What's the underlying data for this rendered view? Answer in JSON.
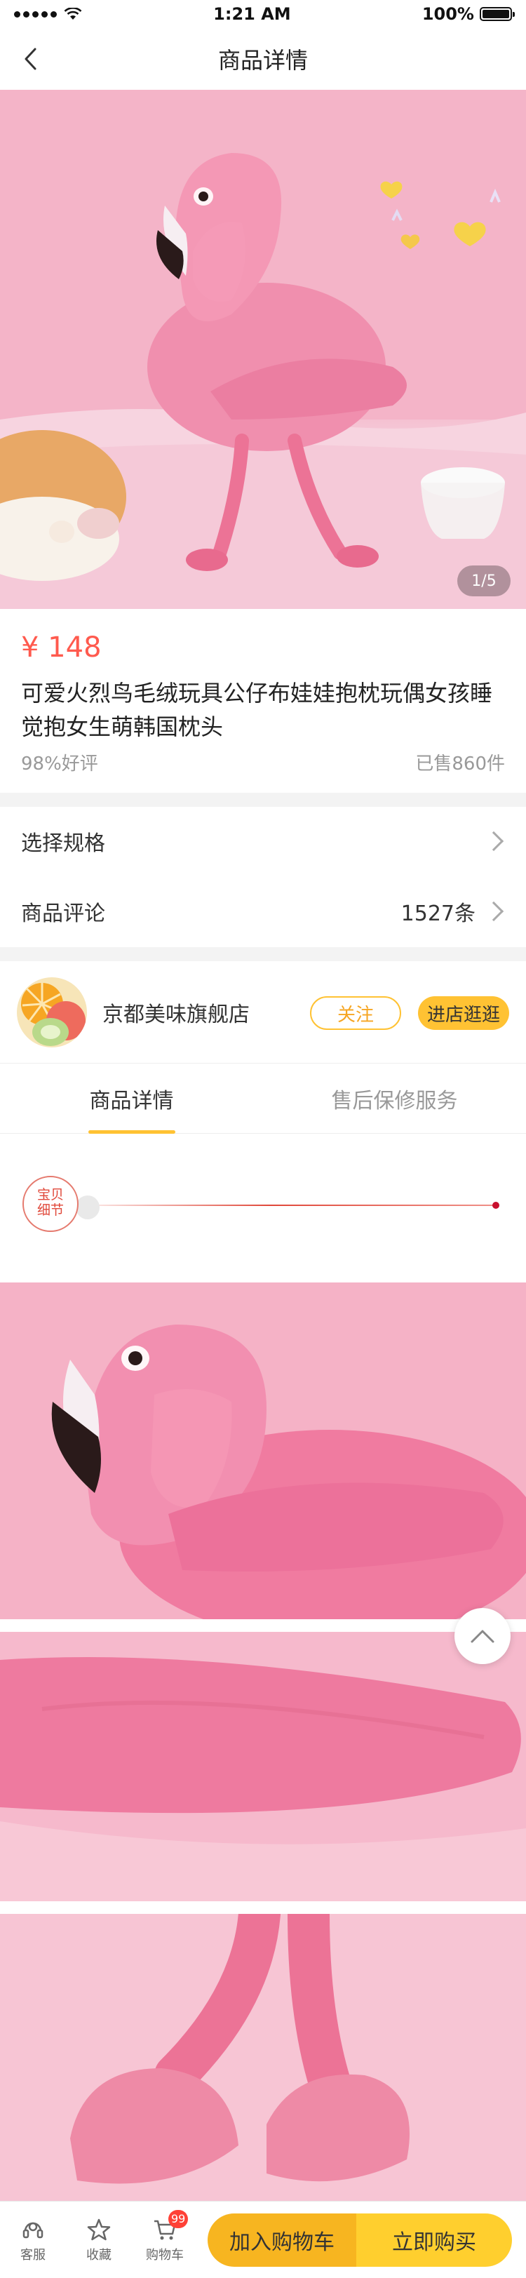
{
  "status_bar": {
    "time": "1:21 AM",
    "battery": "100%",
    "battery_level": 1.0
  },
  "nav": {
    "title": "商品详情",
    "back_icon": "chevron-left-icon"
  },
  "hero": {
    "counter": "1/5"
  },
  "product": {
    "price": "¥ 148",
    "title": "可爱火烈鸟毛绒玩具公仔布娃娃抱枕玩偶女孩睡觉抱女生萌韩国枕头",
    "rating": "98%好评",
    "sold": "已售860件"
  },
  "spec_row": {
    "label": "选择规格"
  },
  "review_row": {
    "label": "商品评论",
    "count": "1527条"
  },
  "store": {
    "name": "京都美味旗舰店",
    "follow": "关注",
    "visit": "进店逛逛"
  },
  "tabs": [
    {
      "label": "商品详情",
      "active": true
    },
    {
      "label": "售后保修服务",
      "active": false
    }
  ],
  "detail_stamp": {
    "line1": "宝贝",
    "line2": "细节"
  },
  "bottom_bar": {
    "service": "客服",
    "favorite": "收藏",
    "cart": "购物车",
    "cart_badge": "99",
    "add_to_cart": "加入购物车",
    "buy_now": "立即购买"
  },
  "colors": {
    "accent": "#ffc233",
    "price": "#ff5a4e",
    "badge": "#ff4136",
    "flamingo_pink": "#f07aa0"
  }
}
